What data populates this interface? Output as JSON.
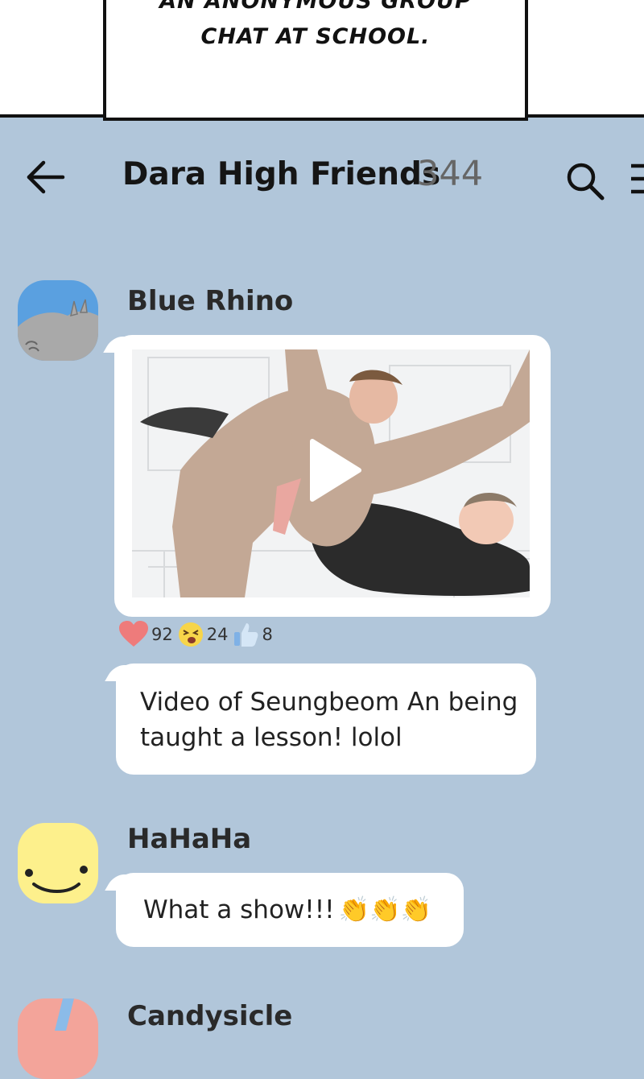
{
  "caption": {
    "line1": "AN ANONYMOUS GROUP",
    "line2": "CHAT AT SCHOOL."
  },
  "header": {
    "title": "Dara High Friends",
    "member_count": "344",
    "back_icon": "arrow-left-icon",
    "search_icon": "search-icon",
    "menu_icon": "hamburger-menu-icon"
  },
  "messages": [
    {
      "sender": "Blue Rhino",
      "avatar_color": "#5aa0e0",
      "video": {
        "play_icon": "play-icon"
      },
      "reactions": [
        {
          "icon": "heart-icon",
          "count": "92"
        },
        {
          "icon": "laughing-face-icon",
          "count": "24"
        },
        {
          "icon": "thumbs-up-icon",
          "count": "8"
        }
      ],
      "text": "Video of Seungbeom An being taught a lesson! lolol"
    },
    {
      "sender": "HaHaHa",
      "avatar_color": "#fdf08c",
      "text": "What a show!!!",
      "emoji": "👏👏👏"
    },
    {
      "sender": "Candysicle",
      "avatar_color": "#f3a49a"
    }
  ],
  "colors": {
    "background": "#b1c6da",
    "bubble": "#ffffff",
    "count": "#666666",
    "heart": "#ee7b7b",
    "thumb": "#7fb1e6"
  }
}
